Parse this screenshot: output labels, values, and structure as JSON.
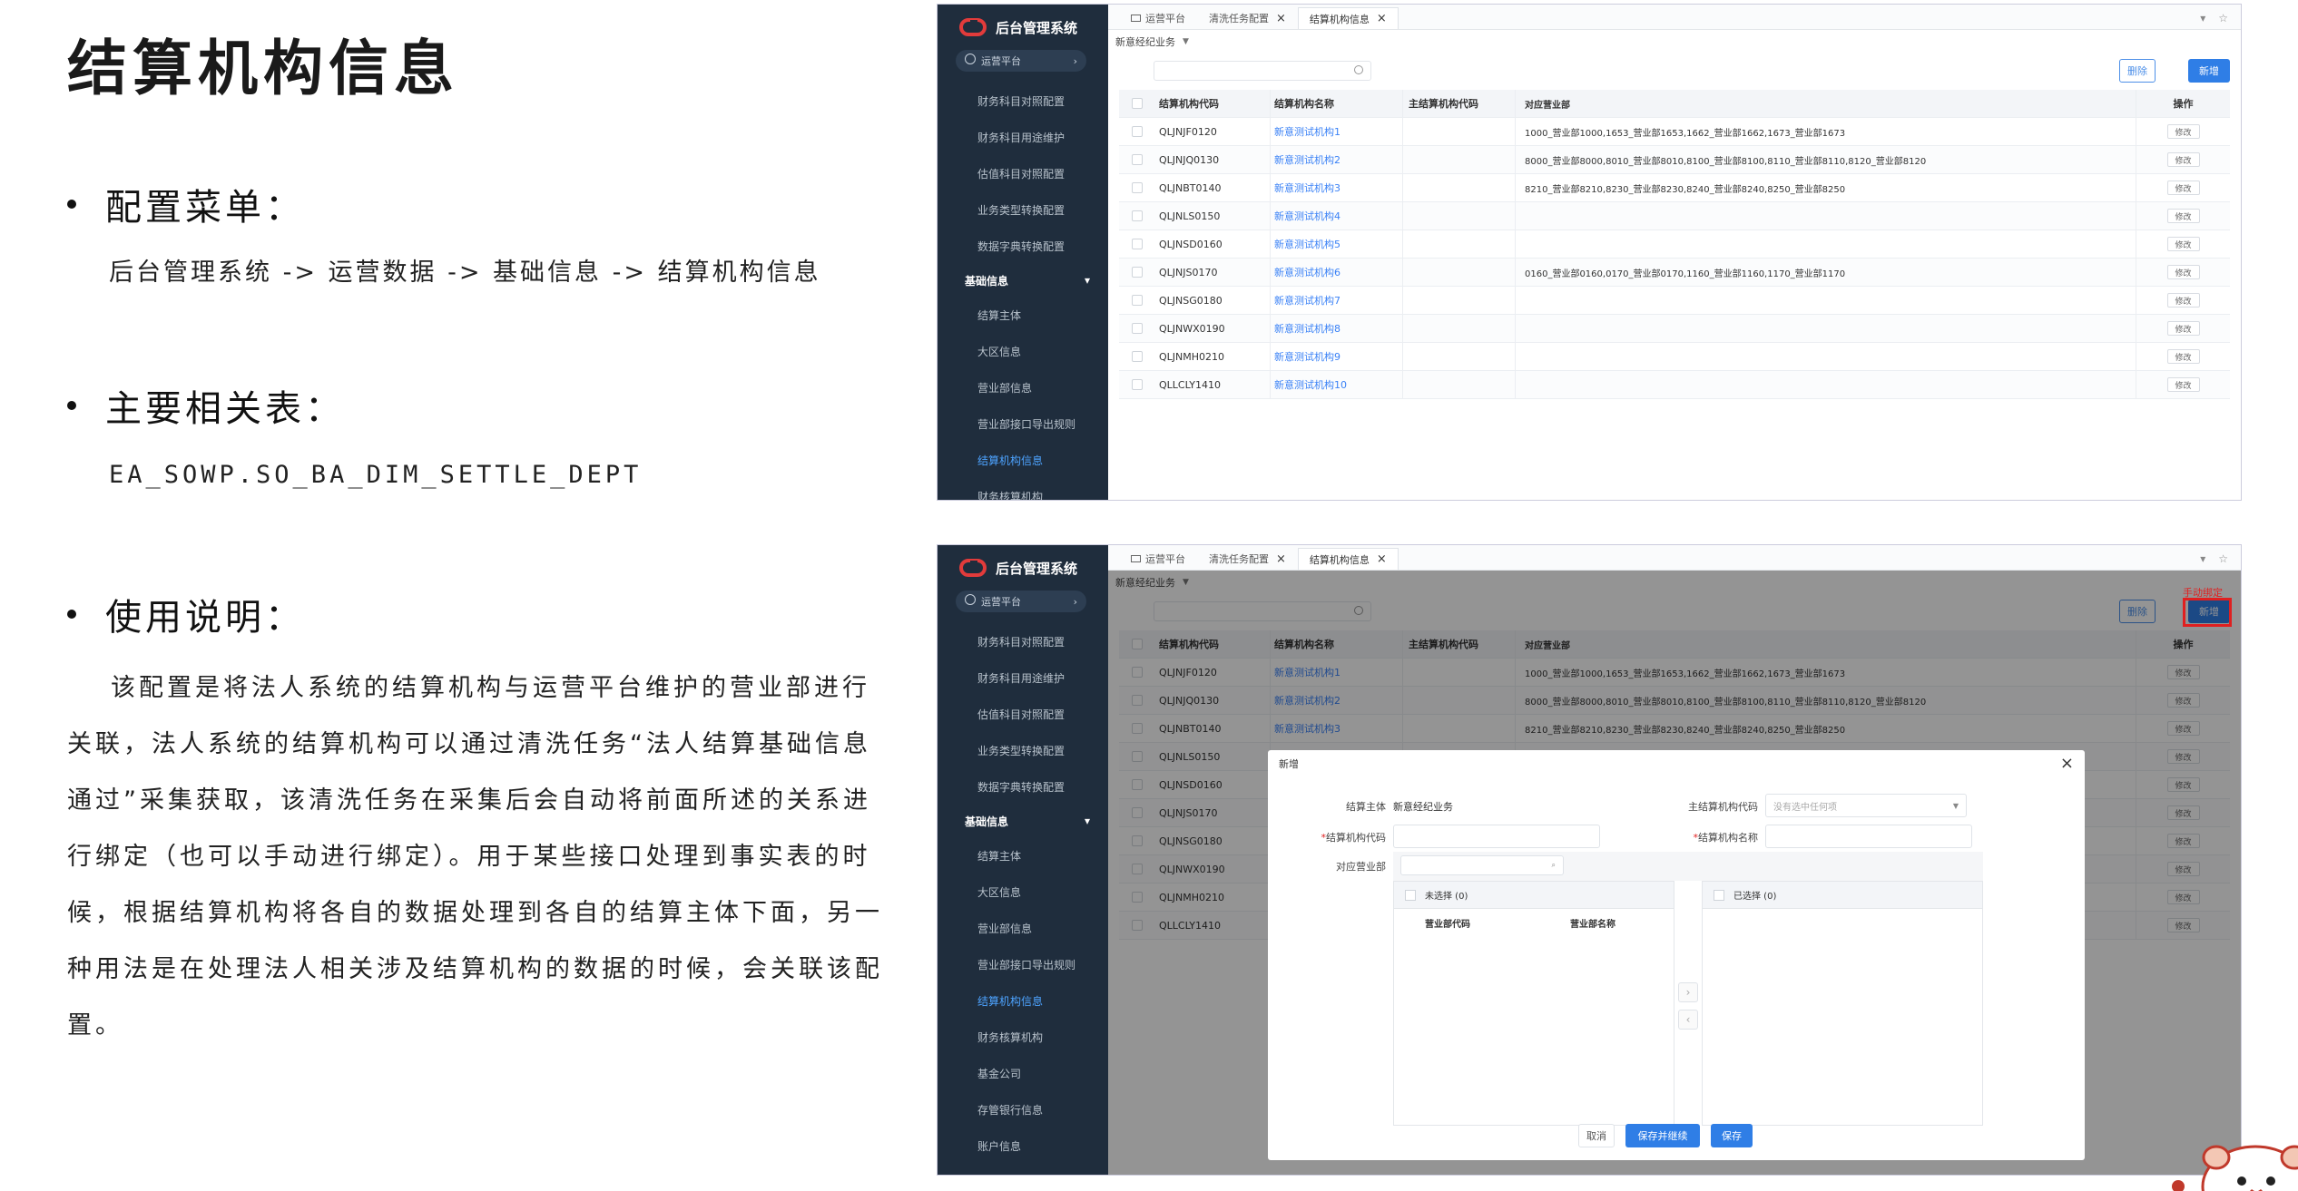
{
  "slide": {
    "title": "结算机构信息",
    "menu_heading": "配置菜单：",
    "menu_path": "后台管理系统 -> 运营数据 -> 基础信息 -> 结算机构信息",
    "tables_heading": "主要相关表：",
    "table_name": "EA_SOWP.SO_BA_DIM_SETTLE_DEPT",
    "usage_heading": "使用说明：",
    "usage_text": "该配置是将法人系统的结算机构与运营平台维护的营业部进行关联，法人系统的结算机构可以通过清洗任务“法人结算基础信息通过”采集获取，该清洗任务在采集后会自动将前面所述的关系进行绑定（也可以手动进行绑定）。用于某些接口处理到事实表的时候，根据结算机构将各自的数据处理到各自的结算主体下面，另一种用法是在处理法人相关涉及结算机构的数据的时候，会关联该配置。"
  },
  "app": {
    "logo_text": "后台管理系统",
    "platform_label": "运营平台",
    "tabs": [
      "运营平台",
      "清洗任务配置",
      "结算机构信息"
    ],
    "entity_selector": "新意经纪业务",
    "search_placeholder": "",
    "delete_label": "删除",
    "add_label": "新增",
    "manual_bind_note": "手动绑定",
    "sidebar_top": [
      "财务科目对照配置",
      "财务科目用途维护",
      "估值科目对照配置",
      "业务类型转换配置",
      "数据字典转换配置"
    ],
    "sidebar_group": "基础信息",
    "sidebar_sub_1": [
      "结算主体",
      "大区信息",
      "营业部信息",
      "营业部接口导出规则",
      "结算机构信息",
      "财务核算机构"
    ],
    "sidebar_sub_2": [
      "结算主体",
      "大区信息",
      "营业部信息",
      "营业部接口导出规则",
      "结算机构信息",
      "财务核算机构",
      "基金公司",
      "存管银行信息",
      "账户信息"
    ],
    "columns": [
      "结算机构代码",
      "结算机构名称",
      "主结算机构代码",
      "对应营业部",
      "操作"
    ],
    "rows": [
      {
        "code": "QLJNJF0120",
        "name": "新意测试机构1",
        "main": "",
        "dept": "1000_营业部1000,1653_营业部1653,1662_营业部1662,1673_营业部1673"
      },
      {
        "code": "QLJNJQ0130",
        "name": "新意测试机构2",
        "main": "",
        "dept": "8000_营业部8000,8010_营业部8010,8100_营业部8100,8110_营业部8110,8120_营业部8120"
      },
      {
        "code": "QLJNBT0140",
        "name": "新意测试机构3",
        "main": "",
        "dept": "8210_营业部8210,8230_营业部8230,8240_营业部8240,8250_营业部8250"
      },
      {
        "code": "QLJNLS0150",
        "name": "新意测试机构4",
        "main": "",
        "dept": ""
      },
      {
        "code": "QLJNSD0160",
        "name": "新意测试机构5",
        "main": "",
        "dept": ""
      },
      {
        "code": "QLJNJS0170",
        "name": "新意测试机构6",
        "main": "",
        "dept": "0160_营业部0160,0170_营业部0170,1160_营业部1160,1170_营业部1170"
      },
      {
        "code": "QLJNSG0180",
        "name": "新意测试机构7",
        "main": "",
        "dept": ""
      },
      {
        "code": "QLJNWX0190",
        "name": "新意测试机构8",
        "main": "",
        "dept": ""
      },
      {
        "code": "QLJNMH0210",
        "name": "新意测试机构9",
        "main": "",
        "dept": ""
      },
      {
        "code": "QLLCLY1410",
        "name": "新意测试机构10",
        "main": "",
        "dept": ""
      }
    ],
    "edit_label": "修改"
  },
  "dialog": {
    "title": "新增",
    "entity_label": "结算主体",
    "entity_value": "新意经纪业务",
    "main_code_label": "主结算机构代码",
    "main_code_placeholder": "没有选中任何项",
    "code_label": "结算机构代码",
    "name_label": "结算机构名称",
    "dept_label": "对应营业部",
    "unselected_label": "未选择 (0)",
    "selected_label": "已选择 (0)",
    "col_dept_code": "营业部代码",
    "col_dept_name": "营业部名称",
    "cancel_label": "取消",
    "save_continue_label": "保存并继续",
    "save_label": "保存"
  }
}
